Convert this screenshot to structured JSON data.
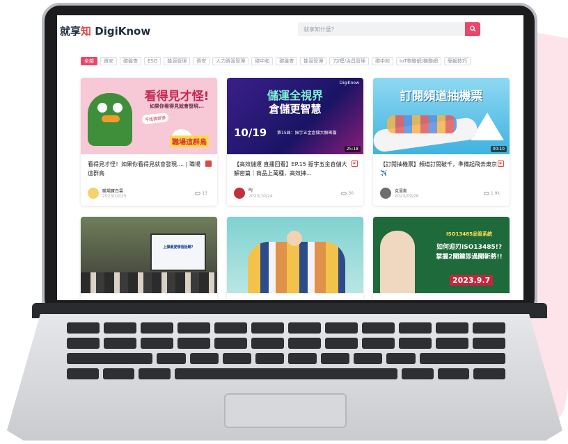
{
  "header": {
    "logo_zh": "就享",
    "logo_accent": "知",
    "logo_en": "DigiKnow",
    "search_placeholder": "就享知什麼？",
    "search_icon": "search-icon"
  },
  "tags": [
    "全部",
    "資安",
    "碳盤查",
    "ESG",
    "能源管理",
    "資安",
    "人力資源管理",
    "碳中和",
    "碳盤查",
    "能源管理",
    "刀/模/治具管理",
    "碳中和",
    "IoT物聯網/機聯網",
    "簡報技巧"
  ],
  "cards": [
    {
      "thumb_title": "看得見才怪!",
      "thumb_sub": "如果你看得見就會發現...",
      "thumb_note": "不找我就慘",
      "thumb_badge": "職場這群鳥",
      "title": "看得見才怪！如果你看得見就會發現.... | 職場這群鳥",
      "type_icon": "document-icon",
      "author": "職場寶白雲",
      "date": "2023/10/25",
      "views": "13"
    },
    {
      "thumb_title": "儲運全視界",
      "thumb_title2": "倉儲更智慧",
      "thumb_date": "10/19",
      "thumb_sub": "第15屆：振宇五金倉儲大解密篇",
      "thumb_brand": "DigiKnow",
      "duration": "25:18",
      "title": "【高效儲運 直播回看】EP.15 振宇五金倉儲大解密篇｜商品上萬種，高效揀...",
      "type_icon": "video-icon",
      "author": "RJ",
      "date": "2023/10/24",
      "views": "30"
    },
    {
      "thumb_title": "訂閱頻道抽機票",
      "duration": "00:10",
      "title": "【訂閱抽機票】頻道訂閱破千，準備起飛去東京✈️",
      "type_icon": "video-icon",
      "author": "克里斯",
      "date": "2023/09/28",
      "views": "1.9k"
    },
    {
      "thumb_title": "",
      "thumb_title2": "上課最愛哪個話題?"
    },
    {
      "thumb_title": ""
    },
    {
      "thumb_title": "如何迎刃ISO13485!?",
      "thumb_title2": "掌握2關鍵即過關斬將!!",
      "thumb_sub": "ISO13485品管系統",
      "thumb_date": "2023.9.7"
    }
  ],
  "colors": {
    "accent": "#e9476a",
    "brand_red": "#e4463f"
  }
}
